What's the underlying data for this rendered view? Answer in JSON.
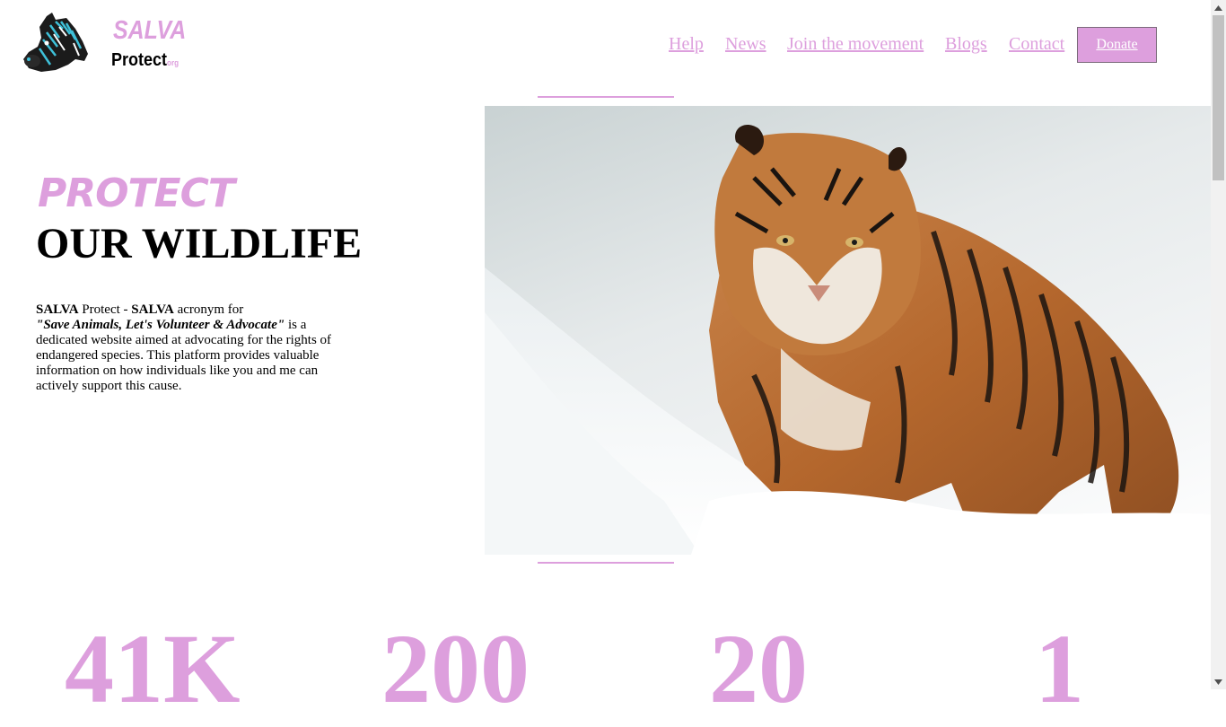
{
  "logo": {
    "title": "SALVA",
    "subtitle": "Protect",
    "suffix": "org",
    "icon": "zebra-icon"
  },
  "nav": {
    "items": [
      {
        "label": "Help"
      },
      {
        "label": "News"
      },
      {
        "label": "Join the movement"
      },
      {
        "label": "Blogs"
      },
      {
        "label": "Contact"
      }
    ],
    "donate_label": "Donate"
  },
  "hero": {
    "headline_accent": "PROTECT",
    "headline_main": "OUR WILDLIFE",
    "description": {
      "part1_bold": "SALVA",
      "part2": " Protect - ",
      "part3_bold": "SALVA",
      "part4": " acronym for",
      "part5_quote": "\"Save Animals, Let's Volunteer & Advocate\"",
      "part6": " is a dedicated website aimed at advocating for the rights of endangered species. This platform provides valuable information on how individuals like you and me can actively support this cause."
    },
    "image": "tiger-in-snow"
  },
  "stats": [
    {
      "value": "41K"
    },
    {
      "value": "200"
    },
    {
      "value": "20"
    },
    {
      "value": "1"
    }
  ],
  "colors": {
    "accent": "#dd9fdd",
    "text": "#000000",
    "background": "#ffffff"
  }
}
